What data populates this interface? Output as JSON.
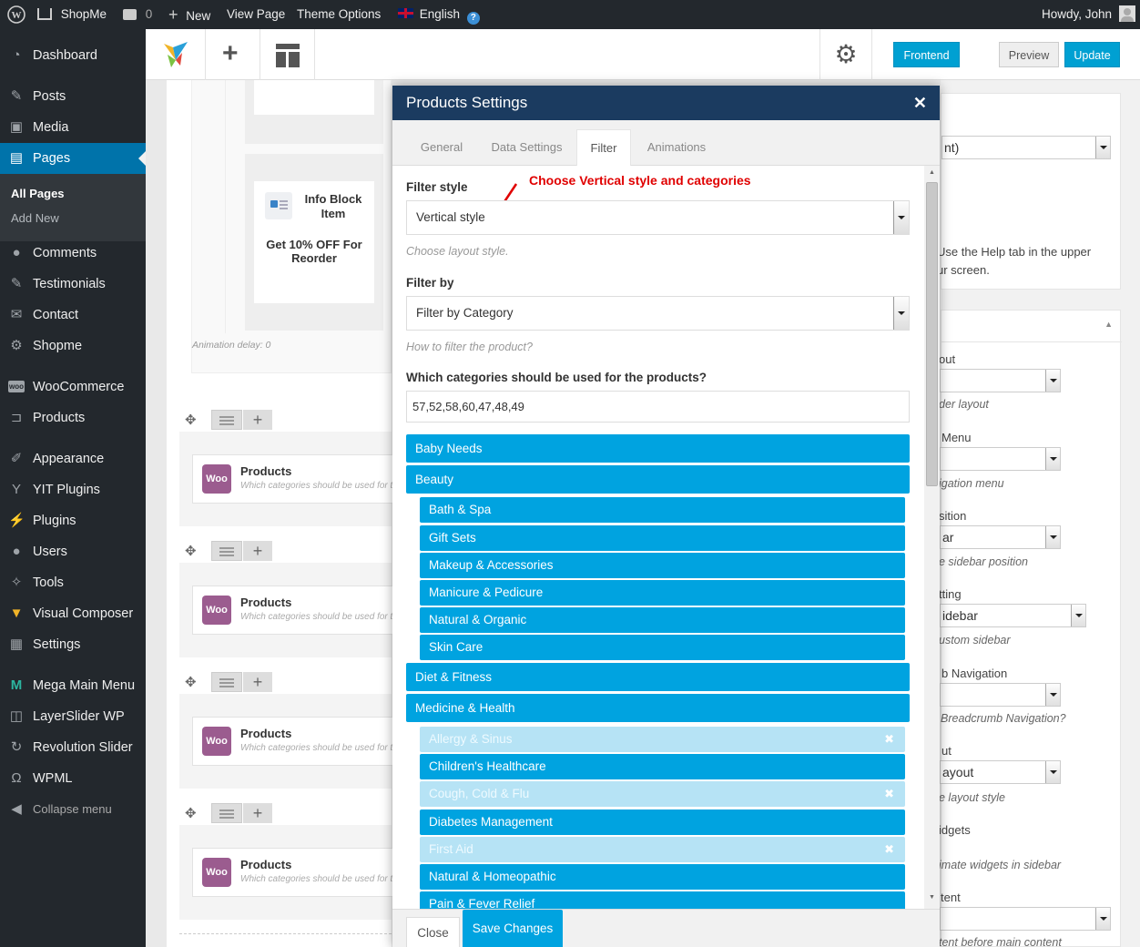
{
  "admin_bar": {
    "site_name": "ShopMe",
    "comments_count": "0",
    "new_label": "New",
    "view_page": "View Page",
    "theme_options": "Theme Options",
    "language": "English",
    "greeting": "Howdy, John"
  },
  "sidebar": {
    "items": [
      {
        "name": "dashboard",
        "label": "Dashboard",
        "icon": "dashboard-icon"
      },
      {
        "name": "posts",
        "label": "Posts",
        "icon": "pin-icon"
      },
      {
        "name": "media",
        "label": "Media",
        "icon": "media-icon"
      },
      {
        "name": "pages",
        "label": "Pages",
        "icon": "page-icon"
      },
      {
        "name": "comments",
        "label": "Comments",
        "icon": "comment-icon"
      },
      {
        "name": "testimonials",
        "label": "Testimonials",
        "icon": "pencil-icon"
      },
      {
        "name": "contact",
        "label": "Contact",
        "icon": "mail-icon"
      },
      {
        "name": "shopme",
        "label": "Shopme",
        "icon": "gear-icon"
      },
      {
        "name": "woocommerce",
        "label": "WooCommerce",
        "icon": "woo-icon"
      },
      {
        "name": "products",
        "label": "Products",
        "icon": "cart-icon"
      },
      {
        "name": "appearance",
        "label": "Appearance",
        "icon": "brush-icon"
      },
      {
        "name": "yit-plugins",
        "label": "YIT Plugins",
        "icon": "yit-icon"
      },
      {
        "name": "plugins",
        "label": "Plugins",
        "icon": "plug-icon"
      },
      {
        "name": "users",
        "label": "Users",
        "icon": "user-icon"
      },
      {
        "name": "tools",
        "label": "Tools",
        "icon": "wrench-icon"
      },
      {
        "name": "visual-composer",
        "label": "Visual Composer",
        "icon": "vc-icon"
      },
      {
        "name": "settings",
        "label": "Settings",
        "icon": "settings-icon"
      },
      {
        "name": "mega-main-menu",
        "label": "Mega Main Menu",
        "icon": "mega-icon"
      },
      {
        "name": "layerslider",
        "label": "LayerSlider WP",
        "icon": "layers-icon"
      },
      {
        "name": "revolution-slider",
        "label": "Revolution Slider",
        "icon": "refresh-icon"
      },
      {
        "name": "wpml",
        "label": "WPML",
        "icon": "wpml-icon"
      },
      {
        "name": "collapse",
        "label": "Collapse menu",
        "icon": "collapse-icon"
      }
    ],
    "sub_all_pages": "All Pages",
    "sub_add_new": "Add New"
  },
  "toolbar": {
    "frontend": "Frontend",
    "preview": "Preview",
    "update": "Update"
  },
  "canvas": {
    "info_block_title": "Info Block Item",
    "info_block_text": "Get 10% OFF For Reorder",
    "animation_delay": "Animation delay: 0",
    "woo_badge": "Woo",
    "product_title": "Products",
    "product_sub": "Which categories should be used for the products?"
  },
  "modal": {
    "title": "Products Settings",
    "tabs": [
      "General",
      "Data Settings",
      "Filter",
      "Animations"
    ],
    "annotation": "Choose Vertical style and categories",
    "filter_style_label": "Filter style",
    "filter_style_value": "Vertical style",
    "filter_style_hint": "Choose layout style.",
    "filter_by_label": "Filter by",
    "filter_by_value": "Filter by Category",
    "filter_by_hint": "How to filter the product?",
    "categories_label": "Which categories should be used for the products?",
    "categories_value": "57,52,58,60,47,48,49",
    "categories": [
      {
        "label": "Baby Needs",
        "level": 0,
        "selected": true
      },
      {
        "label": "Beauty",
        "level": 0,
        "selected": true
      },
      {
        "label": "Bath & Spa",
        "level": 1,
        "selected": true
      },
      {
        "label": "Gift Sets",
        "level": 1,
        "selected": true
      },
      {
        "label": "Makeup & Accessories",
        "level": 1,
        "selected": true
      },
      {
        "label": "Manicure & Pedicure",
        "level": 1,
        "selected": true
      },
      {
        "label": "Natural & Organic",
        "level": 1,
        "selected": true
      },
      {
        "label": "Skin Care",
        "level": 1,
        "selected": true
      },
      {
        "label": "Diet & Fitness",
        "level": 0,
        "selected": true
      },
      {
        "label": "Medicine & Health",
        "level": 0,
        "selected": true
      },
      {
        "label": "Allergy & Sinus",
        "level": 1,
        "selected": false
      },
      {
        "label": "Children's Healthcare",
        "level": 1,
        "selected": true
      },
      {
        "label": "Cough, Cold & Flu",
        "level": 1,
        "selected": false
      },
      {
        "label": "Diabetes Management",
        "level": 1,
        "selected": true
      },
      {
        "label": "First Aid",
        "level": 1,
        "selected": false
      },
      {
        "label": "Natural & Homeopathic",
        "level": 1,
        "selected": true
      },
      {
        "label": "Pain & Fever Relief",
        "level": 1,
        "selected": true
      }
    ],
    "close": "Close",
    "save": "Save Changes"
  },
  "right_panel": {
    "texts": [
      "nt)",
      "Use the Help tab in the upper",
      "ur screen.",
      "out",
      "der layout",
      "Menu",
      "igation menu",
      "sition",
      "ar",
      "e sidebar position",
      "tting",
      "idebar",
      "ustom sidebar",
      "b Navigation",
      "Breadcrumb Navigation?",
      "ut",
      "ayout",
      "e layout style",
      "idgets",
      "imate widgets in sidebar",
      "tent",
      "tent before main content"
    ]
  },
  "colors": {
    "accent": "#0073aa",
    "category": "#00a3e0",
    "modal_header": "#1b3b60",
    "annotation": "#e00000"
  }
}
